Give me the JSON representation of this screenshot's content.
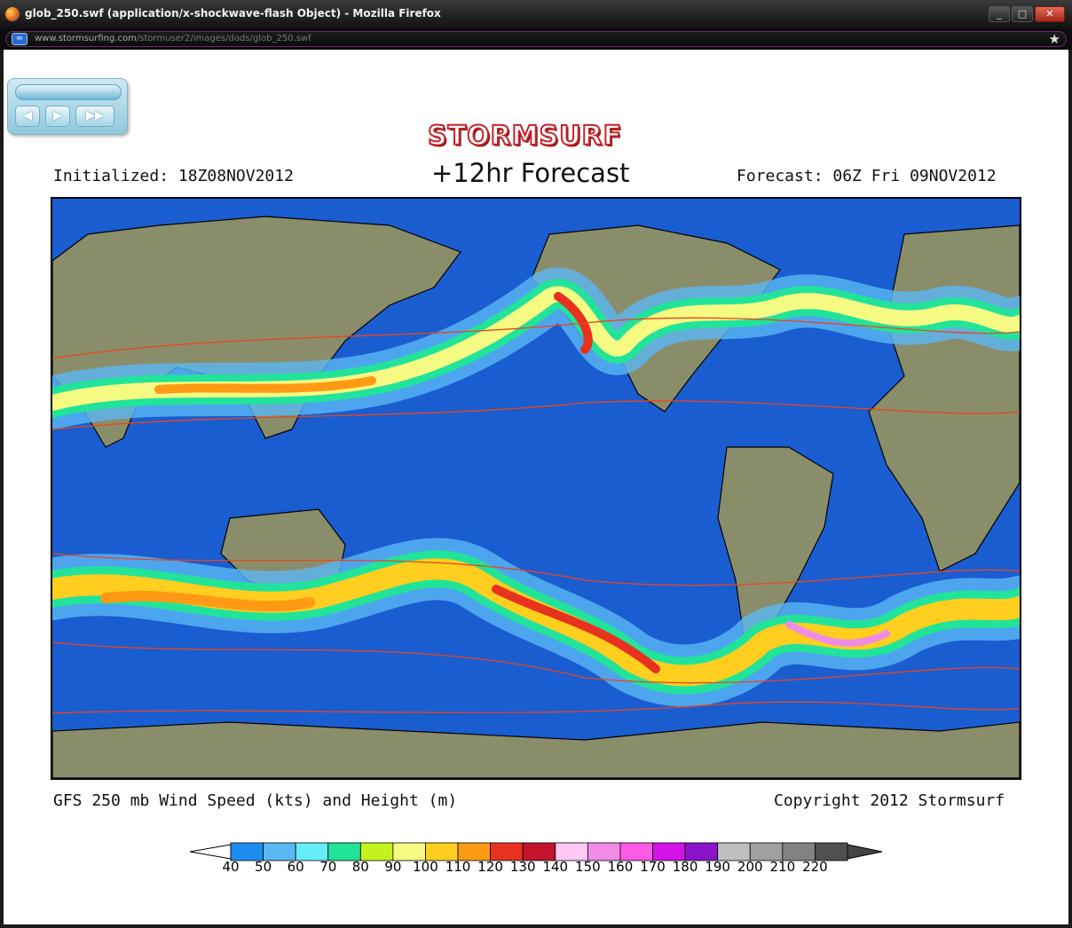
{
  "window": {
    "title": "glob_250.swf (application/x-shockwave-flash Object) - Mozilla Firefox",
    "minimize": "_",
    "maximize": "□",
    "close": "✕"
  },
  "urlbar": {
    "url_host": "www.stormsurfing.com",
    "url_path": "/stormuser2/images/dods/glob_250.swf",
    "site_icon": "site-identity-icon",
    "bookmark_icon": "star-icon"
  },
  "player": {
    "prev": "◀",
    "play": "▶",
    "fast_forward": "▶▶"
  },
  "header": {
    "brand": "STORMSURF",
    "initialized": "Initialized: 18Z08NOV2012",
    "forecast_title": "+12hr Forecast",
    "forecast_time": "Forecast: 06Z Fri 09NOV2012"
  },
  "footer": {
    "caption": "GFS 250 mb Wind Speed (kts) and Height (m)",
    "copyright": "Copyright 2012 Stormsurf"
  },
  "legend": {
    "labels": [
      "40",
      "50",
      "60",
      "70",
      "80",
      "90",
      "100",
      "110",
      "120",
      "130",
      "140",
      "150",
      "160",
      "170",
      "180",
      "190",
      "200",
      "210",
      "220"
    ],
    "colors": [
      "#1e8cf0",
      "#5ab8f5",
      "#66eef8",
      "#22e39a",
      "#c4f21e",
      "#f5fa82",
      "#ffce1e",
      "#ff9a14",
      "#e6321e",
      "#c3142d",
      "#ffc8f5",
      "#f08ce6",
      "#ff5ae6",
      "#d214e6",
      "#8c14c8",
      "#bebebe",
      "#a0a0a0",
      "#828282",
      "#505050"
    ]
  },
  "colors": {
    "ocean": "#1a5dd0",
    "land": "#8a8d6a",
    "height_contour": "#e8461e"
  }
}
